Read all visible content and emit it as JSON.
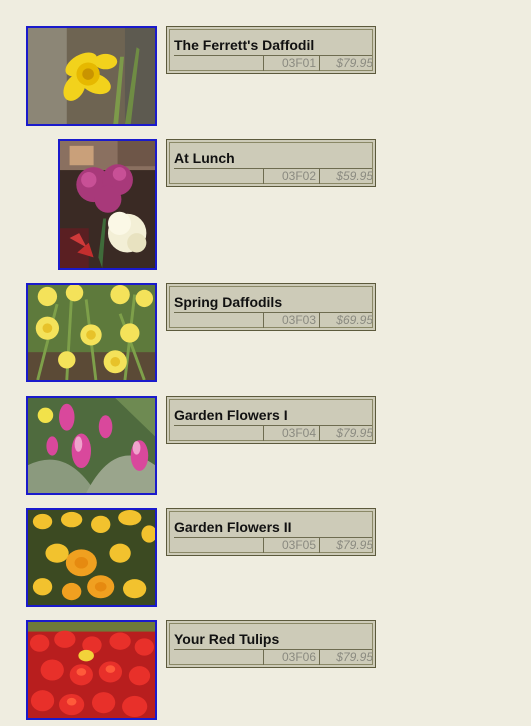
{
  "products": [
    {
      "title": "The Ferrett's Daffodil",
      "code": "03F01",
      "price": "$79.95"
    },
    {
      "title": "At Lunch",
      "code": "03F02",
      "price": "$59.95"
    },
    {
      "title": "Spring Daffodils",
      "code": "03F03",
      "price": "$69.95"
    },
    {
      "title": "Garden Flowers I",
      "code": "03F04",
      "price": "$79.95"
    },
    {
      "title": "Garden Flowers II",
      "code": "03F05",
      "price": "$79.95"
    },
    {
      "title": "Your Red Tulips",
      "code": "03F06",
      "price": "$79.95"
    }
  ],
  "colors": {
    "page_background": "#efede0",
    "thumbnail_border": "#1a1acc",
    "info_box_background": "#cdcbb8"
  },
  "icons": [
    "daffodil-photo",
    "flower-bouquet-photo",
    "daffodils-field-photo",
    "hyacinth-garden-photo",
    "yellow-tulips-photo",
    "red-tulips-photo"
  ]
}
